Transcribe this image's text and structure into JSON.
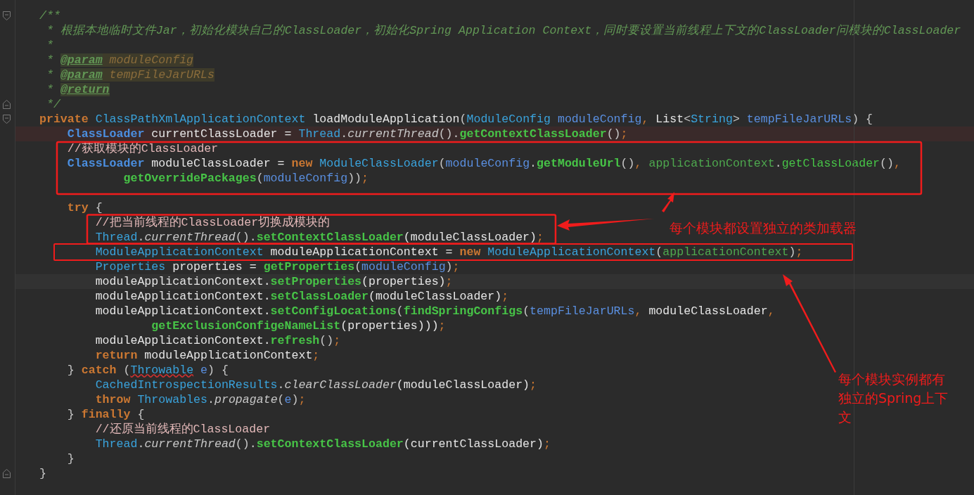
{
  "editor": {
    "lines": [
      {
        "kind": "fold-start",
        "tokens": [
          {
            "text": "/**",
            "kind": "doc"
          }
        ]
      },
      {
        "kind": "code",
        "tokens": [
          {
            "text": " * 根据本地临时文件Jar，初始化模块自己的ClassLoader，初始化Spring Application Context，同时要设置当前线程上下文的ClassLoader问模块的ClassLoader",
            "kind": "doc"
          }
        ]
      },
      {
        "kind": "code",
        "tokens": [
          {
            "text": " *",
            "kind": "doc"
          }
        ]
      },
      {
        "kind": "code",
        "tokens": [
          {
            "text": " * ",
            "kind": "doc"
          },
          {
            "text": "@param",
            "kind": "doctag"
          },
          {
            "text": " moduleConfig",
            "kind": "docvar"
          }
        ]
      },
      {
        "kind": "code",
        "tokens": [
          {
            "text": " * ",
            "kind": "doc"
          },
          {
            "text": "@param",
            "kind": "doctag"
          },
          {
            "text": " tempFileJarURLs",
            "kind": "docvar"
          }
        ]
      },
      {
        "kind": "code",
        "tokens": [
          {
            "text": " * ",
            "kind": "doc"
          },
          {
            "text": "@return",
            "kind": "doctag"
          }
        ]
      },
      {
        "kind": "fold-end",
        "tokens": [
          {
            "text": " */",
            "kind": "doc"
          }
        ]
      },
      {
        "kind": "fold-start",
        "tokens": [
          {
            "text": "private ",
            "kind": "kw"
          },
          {
            "text": "ClassPathXmlApplicationContext",
            "kind": "type"
          },
          {
            "text": " loadModuleApplication",
            "kind": "plain"
          },
          {
            "text": "(",
            "kind": "punct"
          },
          {
            "text": "ModuleConfig ",
            "kind": "type"
          },
          {
            "text": "moduleConfig",
            "kind": "param"
          },
          {
            "text": ", ",
            "kind": "semi"
          },
          {
            "text": "List",
            "kind": "plain"
          },
          {
            "text": "<",
            "kind": "punct"
          },
          {
            "text": "String",
            "kind": "type"
          },
          {
            "text": "> ",
            "kind": "punct"
          },
          {
            "text": "tempFileJarURLs",
            "kind": "param"
          },
          {
            "text": ") {",
            "kind": "punct"
          }
        ]
      },
      {
        "kind": "error-line",
        "tokens": [
          {
            "text": "    ClassLoader",
            "kind": "typeb"
          },
          {
            "text": " currentClassLoader = ",
            "kind": "plain"
          },
          {
            "text": "Thread",
            "kind": "type"
          },
          {
            "text": ".",
            "kind": "punct"
          },
          {
            "text": "currentThread",
            "kind": "call"
          },
          {
            "text": "().",
            "kind": "punct"
          },
          {
            "text": "getContextClassLoader",
            "kind": "method"
          },
          {
            "text": "()",
            "kind": "punct"
          },
          {
            "text": ";",
            "kind": "semi"
          }
        ]
      },
      {
        "kind": "code",
        "tokens": [
          {
            "text": "    //获取模块的ClassLoader",
            "kind": "lc"
          }
        ]
      },
      {
        "kind": "code",
        "tokens": [
          {
            "text": "    ClassLoader",
            "kind": "typeb"
          },
          {
            "text": " moduleClassLoader = ",
            "kind": "plain"
          },
          {
            "text": "new ",
            "kind": "kw"
          },
          {
            "text": "ModuleClassLoader",
            "kind": "type"
          },
          {
            "text": "(",
            "kind": "punct"
          },
          {
            "text": "moduleConfig",
            "kind": "param"
          },
          {
            "text": ".",
            "kind": "punct"
          },
          {
            "text": "getModuleUrl",
            "kind": "method"
          },
          {
            "text": "()",
            "kind": "punct"
          },
          {
            "text": ", ",
            "kind": "semi"
          },
          {
            "text": "applicationContext",
            "kind": "field"
          },
          {
            "text": ".",
            "kind": "punct"
          },
          {
            "text": "getClassLoader",
            "kind": "methodl"
          },
          {
            "text": "()",
            "kind": "punct"
          },
          {
            "text": ",",
            "kind": "semi"
          }
        ]
      },
      {
        "kind": "code",
        "tokens": [
          {
            "text": "            getOverridePackages",
            "kind": "method"
          },
          {
            "text": "(",
            "kind": "punct"
          },
          {
            "text": "moduleConfig",
            "kind": "param"
          },
          {
            "text": "))",
            "kind": "punct"
          },
          {
            "text": ";",
            "kind": "semi"
          }
        ]
      },
      {
        "kind": "blank"
      },
      {
        "kind": "code",
        "tokens": [
          {
            "text": "    try",
            "kind": "kw"
          },
          {
            "text": " {",
            "kind": "punct"
          }
        ]
      },
      {
        "kind": "code",
        "tokens": [
          {
            "text": "        //把当前线程的ClassLoader切换成模块的",
            "kind": "lc"
          }
        ]
      },
      {
        "kind": "code",
        "tokens": [
          {
            "text": "        Thread",
            "kind": "type"
          },
          {
            "text": ".",
            "kind": "punct"
          },
          {
            "text": "currentThread",
            "kind": "call"
          },
          {
            "text": "().",
            "kind": "punct"
          },
          {
            "text": "setContextClassLoader",
            "kind": "method"
          },
          {
            "text": "(moduleClassLoader)",
            "kind": "plain"
          },
          {
            "text": ";",
            "kind": "semi"
          }
        ]
      },
      {
        "kind": "code",
        "tokens": [
          {
            "text": "        ModuleApplicationContext",
            "kind": "type"
          },
          {
            "text": " moduleApplicationContext = ",
            "kind": "plain"
          },
          {
            "text": "new ",
            "kind": "kw"
          },
          {
            "text": "ModuleApplicationContext",
            "kind": "type"
          },
          {
            "text": "(",
            "kind": "punct"
          },
          {
            "text": "applicationContext",
            "kind": "field"
          },
          {
            "text": ")",
            "kind": "punct"
          },
          {
            "text": ";",
            "kind": "semi"
          }
        ]
      },
      {
        "kind": "code",
        "tokens": [
          {
            "text": "        Properties",
            "kind": "type"
          },
          {
            "text": " properties = ",
            "kind": "plain"
          },
          {
            "text": "getProperties",
            "kind": "method"
          },
          {
            "text": "(",
            "kind": "punct"
          },
          {
            "text": "moduleConfig",
            "kind": "param"
          },
          {
            "text": ")",
            "kind": "punct"
          },
          {
            "text": ";",
            "kind": "semi"
          }
        ]
      },
      {
        "kind": "current-line",
        "tokens": [
          {
            "text": "        moduleApplicationContext.",
            "kind": "plain"
          },
          {
            "text": "setProperties",
            "kind": "method"
          },
          {
            "text": "(properties)",
            "kind": "plain"
          },
          {
            "text": ";",
            "kind": "semi"
          }
        ]
      },
      {
        "kind": "code",
        "tokens": [
          {
            "text": "        moduleApplicationContext.",
            "kind": "plain"
          },
          {
            "text": "setClassLoader",
            "kind": "method"
          },
          {
            "text": "(moduleClassLoader)",
            "kind": "plain"
          },
          {
            "text": ";",
            "kind": "semi"
          }
        ]
      },
      {
        "kind": "code",
        "tokens": [
          {
            "text": "        moduleApplicationContext.",
            "kind": "plain"
          },
          {
            "text": "setConfigLocations",
            "kind": "method"
          },
          {
            "text": "(",
            "kind": "punct"
          },
          {
            "text": "findSpringConfigs",
            "kind": "method"
          },
          {
            "text": "(",
            "kind": "punct"
          },
          {
            "text": "tempFileJarURLs",
            "kind": "param"
          },
          {
            "text": ", ",
            "kind": "semi"
          },
          {
            "text": "moduleClassLoader",
            "kind": "plain"
          },
          {
            "text": ",",
            "kind": "semi"
          }
        ]
      },
      {
        "kind": "code",
        "tokens": [
          {
            "text": "                getExclusionConfigeNameList",
            "kind": "method"
          },
          {
            "text": "(properties)))",
            "kind": "plain"
          },
          {
            "text": ";",
            "kind": "semi"
          }
        ]
      },
      {
        "kind": "code",
        "tokens": [
          {
            "text": "        moduleApplicationContext.",
            "kind": "plain"
          },
          {
            "text": "refresh",
            "kind": "method"
          },
          {
            "text": "()",
            "kind": "punct"
          },
          {
            "text": ";",
            "kind": "semi"
          }
        ]
      },
      {
        "kind": "code",
        "tokens": [
          {
            "text": "        return",
            "kind": "kw"
          },
          {
            "text": " moduleApplicationContext",
            "kind": "plain"
          },
          {
            "text": ";",
            "kind": "semi"
          }
        ]
      },
      {
        "kind": "code",
        "tokens": [
          {
            "text": "    } ",
            "kind": "punct"
          },
          {
            "text": "catch",
            "kind": "kw"
          },
          {
            "text": " (",
            "kind": "punct"
          },
          {
            "text": "Throwable",
            "kind": "err"
          },
          {
            "text": " e",
            "kind": "param"
          },
          {
            "text": ") {",
            "kind": "punct"
          }
        ]
      },
      {
        "kind": "code",
        "tokens": [
          {
            "text": "        CachedIntrospectionResults",
            "kind": "type"
          },
          {
            "text": ".",
            "kind": "punct"
          },
          {
            "text": "clearClassLoader",
            "kind": "call"
          },
          {
            "text": "(moduleClassLoader)",
            "kind": "plain"
          },
          {
            "text": ";",
            "kind": "semi"
          }
        ]
      },
      {
        "kind": "code",
        "tokens": [
          {
            "text": "        throw ",
            "kind": "kw"
          },
          {
            "text": "Throwables",
            "kind": "type"
          },
          {
            "text": ".",
            "kind": "punct"
          },
          {
            "text": "propagate",
            "kind": "call"
          },
          {
            "text": "(",
            "kind": "punct"
          },
          {
            "text": "e",
            "kind": "param"
          },
          {
            "text": ")",
            "kind": "punct"
          },
          {
            "text": ";",
            "kind": "semi"
          }
        ]
      },
      {
        "kind": "code",
        "tokens": [
          {
            "text": "    } ",
            "kind": "punct"
          },
          {
            "text": "finally",
            "kind": "kw"
          },
          {
            "text": " {",
            "kind": "punct"
          }
        ]
      },
      {
        "kind": "code",
        "tokens": [
          {
            "text": "        //还原当前线程的ClassLoader",
            "kind": "lc"
          }
        ]
      },
      {
        "kind": "code",
        "tokens": [
          {
            "text": "        Thread",
            "kind": "type"
          },
          {
            "text": ".",
            "kind": "punct"
          },
          {
            "text": "currentThread",
            "kind": "call"
          },
          {
            "text": "().",
            "kind": "punct"
          },
          {
            "text": "setContextClassLoader",
            "kind": "method"
          },
          {
            "text": "(currentClassLoader)",
            "kind": "plain"
          },
          {
            "text": ";",
            "kind": "semi"
          }
        ]
      },
      {
        "kind": "code",
        "tokens": [
          {
            "text": "    }",
            "kind": "punct"
          }
        ]
      },
      {
        "kind": "fold-end",
        "tokens": [
          {
            "text": "}",
            "kind": "punct"
          }
        ]
      }
    ]
  },
  "callouts": [
    "每个模块都设置独立的类加载器",
    "每个模块实例都有独立的Spring上下文"
  ]
}
